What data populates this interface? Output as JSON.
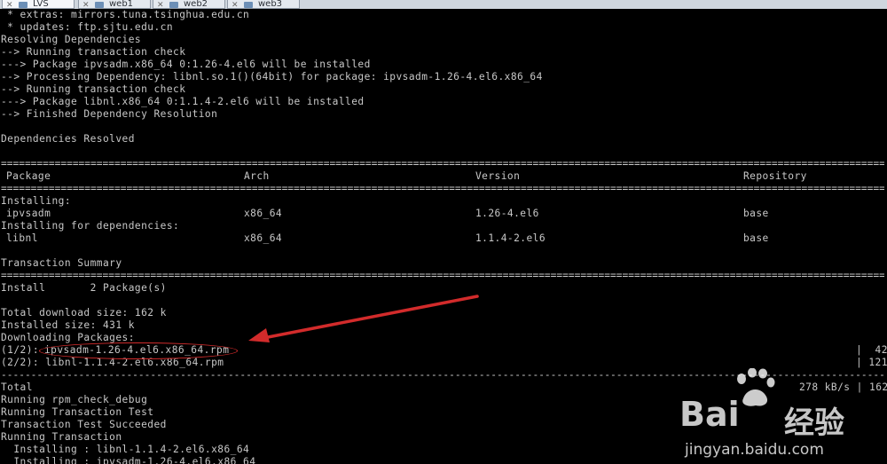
{
  "tabs": [
    {
      "label": "LVS",
      "active": true
    },
    {
      "label": "web1",
      "active": false
    },
    {
      "label": "web2",
      "active": false
    },
    {
      "label": "web3",
      "active": false
    }
  ],
  "terminal": {
    "lines": [
      " * extras: mirrors.tuna.tsinghua.edu.cn",
      " * updates: ftp.sjtu.edu.cn",
      "Resolving Dependencies",
      "--> Running transaction check",
      "---> Package ipvsadm.x86_64 0:1.26-4.el6 will be installed",
      "--> Processing Dependency: libnl.so.1()(64bit) for package: ipvsadm-1.26-4.el6.x86_64",
      "--> Running transaction check",
      "---> Package libnl.x86_64 0:1.1.4-2.el6 will be installed",
      "--> Finished Dependency Resolution",
      "",
      "Dependencies Resolved"
    ],
    "table": {
      "headers": [
        "Package",
        "Arch",
        "Version",
        "Repository"
      ],
      "installing_label": "Installing:",
      "deps_label": "Installing for dependencies:",
      "rows": [
        {
          "package": "ipvsadm",
          "arch": "x86_64",
          "version": "1.26-4.el6",
          "repo": "base"
        },
        {
          "package": "libnl",
          "arch": "x86_64",
          "version": "1.1.4-2.el6",
          "repo": "base"
        }
      ]
    },
    "summary": {
      "title": "Transaction Summary",
      "install_line": "Install       2 Package(s)",
      "download_size": "Total download size: 162 k",
      "installed_size": "Installed size: 431 k",
      "downloading": "Downloading Packages:",
      "dl1_prefix": "(1/2): ",
      "dl1_file": "ipvsadm-1.26-4.el6.x86_64.rpm",
      "dl1_size": "|  42",
      "dl2": "(2/2): libnl-1.1.4-2.el6.x86_64.rpm",
      "dl2_size": "| 121",
      "total_label": "Total",
      "total_rate": "278 kB/s | 162"
    },
    "tail_lines": [
      "Running rpm_check_debug",
      "Running Transaction Test",
      "Transaction Test Succeeded",
      "Running Transaction",
      "  Installing : libnl-1.1.4-2.el6.x86_64",
      "  Installing : ipvsadm-1.26-4.el6.x86_64"
    ]
  },
  "watermark": {
    "brand_left": "Bai",
    "brand_right": "经验",
    "url": "jingyan.baidu.com"
  },
  "colors": {
    "annotation": "#d22b2b",
    "terminal_text": "#c8c8c8",
    "terminal_bg": "#000000"
  }
}
